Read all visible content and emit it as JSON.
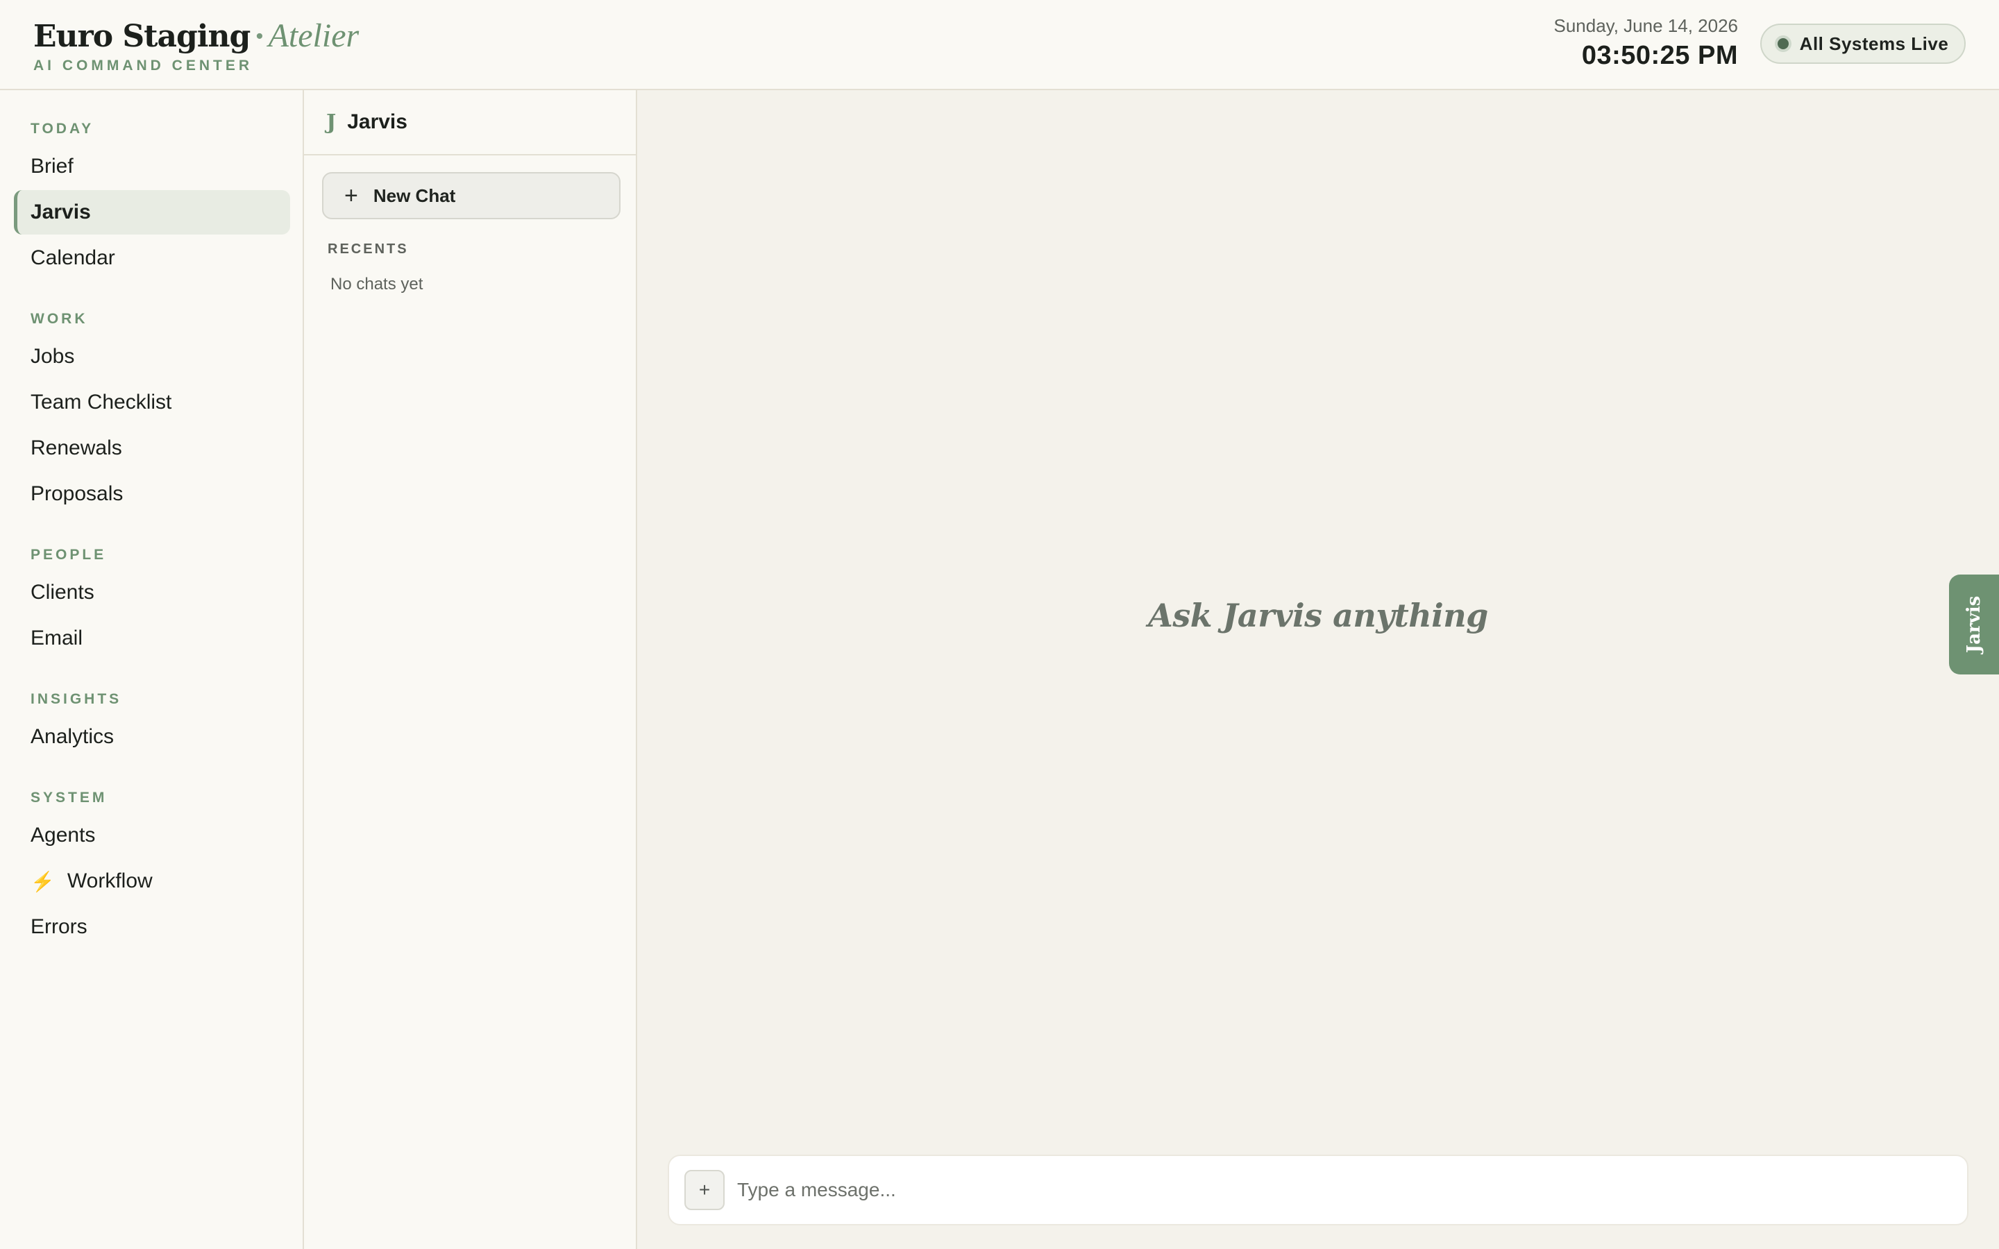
{
  "header": {
    "brand_title": "Euro Staging",
    "brand_separator": "·",
    "brand_italic": "Atelier",
    "brand_subtitle": "AI COMMAND CENTER",
    "date": "Sunday, June 14, 2026",
    "time": "03:50:25 PM",
    "status_label": "All Systems Live"
  },
  "nav": {
    "sections": [
      {
        "title": "TODAY",
        "items": [
          "Brief",
          "Jarvis",
          "Calendar"
        ]
      },
      {
        "title": "WORK",
        "items": [
          "Jobs",
          "Team Checklist",
          "Renewals",
          "Proposals"
        ]
      },
      {
        "title": "PEOPLE",
        "items": [
          "Clients",
          "Email"
        ]
      },
      {
        "title": "INSIGHTS",
        "items": [
          "Analytics"
        ]
      },
      {
        "title": "SYSTEM",
        "items": [
          "Agents",
          "Workflow",
          "Errors"
        ]
      }
    ],
    "active_item": "Jarvis",
    "workflow_icon": "bolt-icon"
  },
  "chatlist": {
    "icon_letter": "J",
    "title": "Jarvis",
    "new_chat_label": "New Chat",
    "recents_title": "RECENTS",
    "empty_text": "No chats yet"
  },
  "main": {
    "empty_prompt": "Ask Jarvis anything",
    "composer": {
      "attach_label": "+",
      "placeholder": "Type a message..."
    }
  },
  "side_tab": {
    "label": "Jarvis"
  },
  "colors": {
    "accent": "#6e9272",
    "status_dot": "#4f6a52",
    "bolt": "#e6b23a"
  }
}
